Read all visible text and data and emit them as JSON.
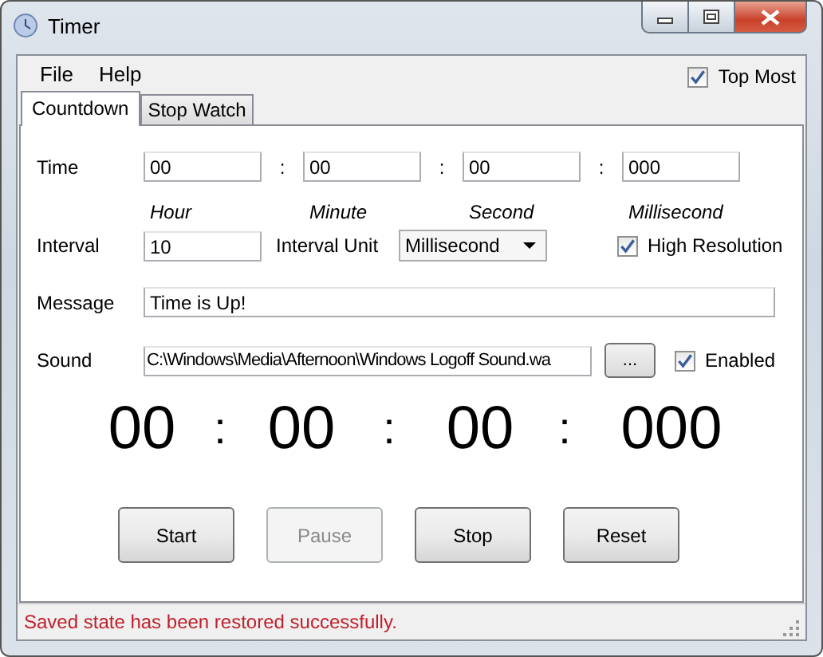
{
  "window": {
    "title": "Timer"
  },
  "menu": [
    "File",
    "Help"
  ],
  "top_most": {
    "label": "Top Most",
    "checked": true
  },
  "tabs": [
    {
      "label": "Countdown",
      "selected": true
    },
    {
      "label": "Stop Watch",
      "selected": false
    }
  ],
  "time": {
    "label": "Time",
    "fields": [
      {
        "value": "00",
        "unit": "Hour"
      },
      {
        "value": "00",
        "unit": "Minute"
      },
      {
        "value": "00",
        "unit": "Second"
      },
      {
        "value": "000",
        "unit": "Millisecond"
      }
    ],
    "separators": [
      ":",
      ":",
      ":"
    ]
  },
  "interval": {
    "label": "Interval",
    "value": "10",
    "unit_label": "Interval Unit",
    "unit_value": "Millisecond"
  },
  "high_resolution": {
    "label": "High Resolution",
    "checked": true
  },
  "message": {
    "label": "Message",
    "value": "Time is Up!"
  },
  "sound": {
    "label": "Sound",
    "value": "C:\\Windows\\Media\\Afternoon\\Windows Logoff Sound.wa",
    "browse": "...",
    "enabled": {
      "label": "Enabled",
      "checked": true
    }
  },
  "display": [
    "00",
    ":",
    "00",
    ":",
    "00",
    ":",
    "000"
  ],
  "buttons": [
    {
      "label": "Start",
      "disabled": false
    },
    {
      "label": "Pause",
      "disabled": true
    },
    {
      "label": "Stop",
      "disabled": false
    },
    {
      "label": "Reset",
      "disabled": false
    }
  ],
  "status_bar": {
    "text": "Saved state has been restored successfully."
  }
}
